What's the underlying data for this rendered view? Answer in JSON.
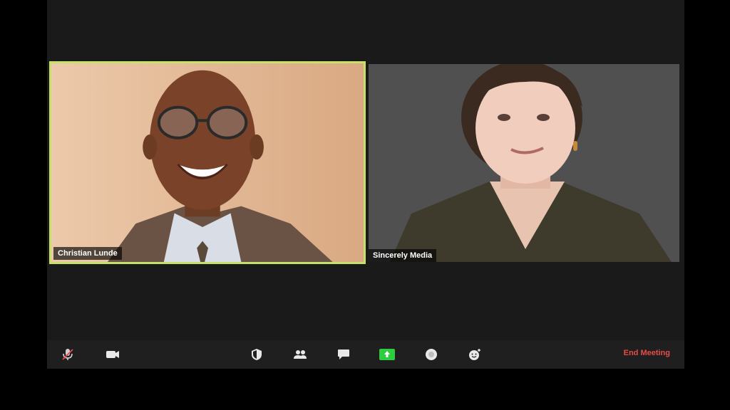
{
  "participants": [
    {
      "name": "Christian Lunde",
      "active_speaker": true
    },
    {
      "name": "Sincerely Media",
      "active_speaker": false
    }
  ],
  "toolbar": {
    "end_meeting_label": "End Meeting",
    "share_color": "#2ecc40",
    "end_color": "#e94a4a"
  },
  "colors": {
    "active_speaker_border": "#c6e06a"
  }
}
